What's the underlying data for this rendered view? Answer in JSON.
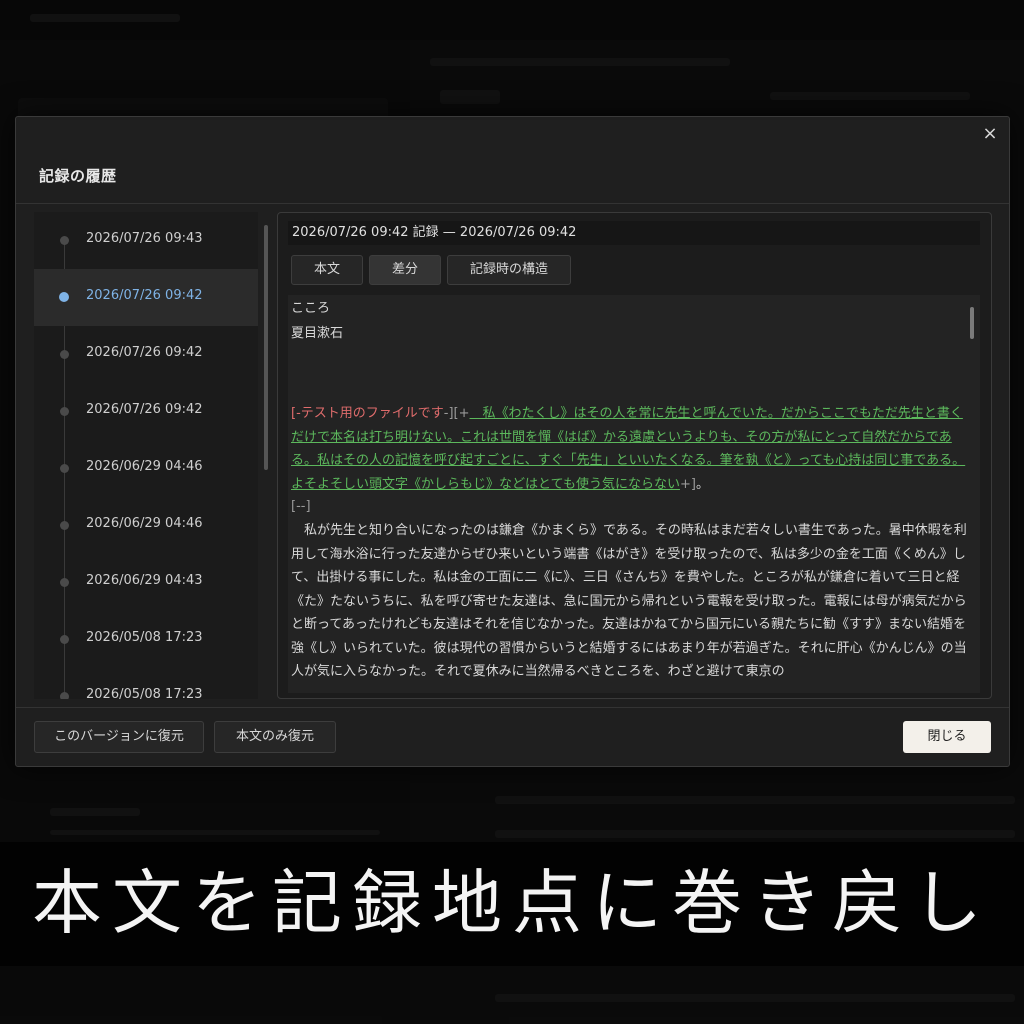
{
  "modal": {
    "title": "記録の履歴",
    "close_icon": "×"
  },
  "history": {
    "items": [
      {
        "time": "2026/07/26 09:43",
        "selected": false
      },
      {
        "time": "2026/07/26 09:42",
        "selected": true
      },
      {
        "time": "2026/07/26 09:42",
        "selected": false
      },
      {
        "time": "2026/07/26 09:42",
        "selected": false
      },
      {
        "time": "2026/06/29 04:46",
        "selected": false
      },
      {
        "time": "2026/06/29 04:46",
        "selected": false
      },
      {
        "time": "2026/06/29 04:43",
        "selected": false
      },
      {
        "time": "2026/05/08 17:23",
        "selected": false
      },
      {
        "time": "2026/05/08 17:23",
        "selected": false
      }
    ]
  },
  "detail": {
    "header": "2026/07/26 09:42 記録 — 2026/07/26 09:42",
    "tabs": [
      "本文",
      "差分",
      "記録時の構造"
    ],
    "active_tab": "差分",
    "title_line": "こころ",
    "author_line": "夏目漱石",
    "diff_open_del": "[-",
    "diff_deleted": "テスト用のファイルです",
    "diff_close_del": "-]",
    "diff_open_ins": "[+",
    "diff_inserted": "　私《わたくし》はその人を常に先生と呼んでいた。だからここでもただ先生と書くだけで本名は打ち明けない。これは世間を憚《はば》かる遠慮というよりも、その方が私にとって自然だからである。私はその人の記憶を呼び起すごとに、すぐ「先生」といいたくなる。筆を執《と》っても心持は同じ事である。よそよそしい頭文字《かしらもじ》などはとても使う気にならない",
    "diff_close_ins": "+]",
    "diff_after_ins": "。",
    "diff_marker": "[--]",
    "body_text": "　私が先生と知り合いになったのは鎌倉《かまくら》である。その時私はまだ若々しい書生であった。暑中休暇を利用して海水浴に行った友達からぜひ来いという端書《はがき》を受け取ったので、私は多少の金を工面《くめん》して、出掛ける事にした。私は金の工面に二《に》、三日《さんち》を費やした。ところが私が鎌倉に着いて三日と経《た》たないうちに、私を呼び寄せた友達は、急に国元から帰れという電報を受け取った。電報には母が病気だからと断ってあったけれども友達はそれを信じなかった。友達はかねてから国元にいる親たちに勧《すす》まない結婚を強《し》いられていた。彼は現代の習慣からいうと結婚するにはあまり年が若過ぎた。それに肝心《かんじん》の当人が気に入らなかった。それで夏休みに当然帰るべきところを、わざと避けて東京の"
  },
  "footer": {
    "restore_version": "このバージョンに復元",
    "restore_body": "本文のみ復元",
    "close": "閉じる"
  },
  "caption": "本文を記録地点に巻き戻し"
}
